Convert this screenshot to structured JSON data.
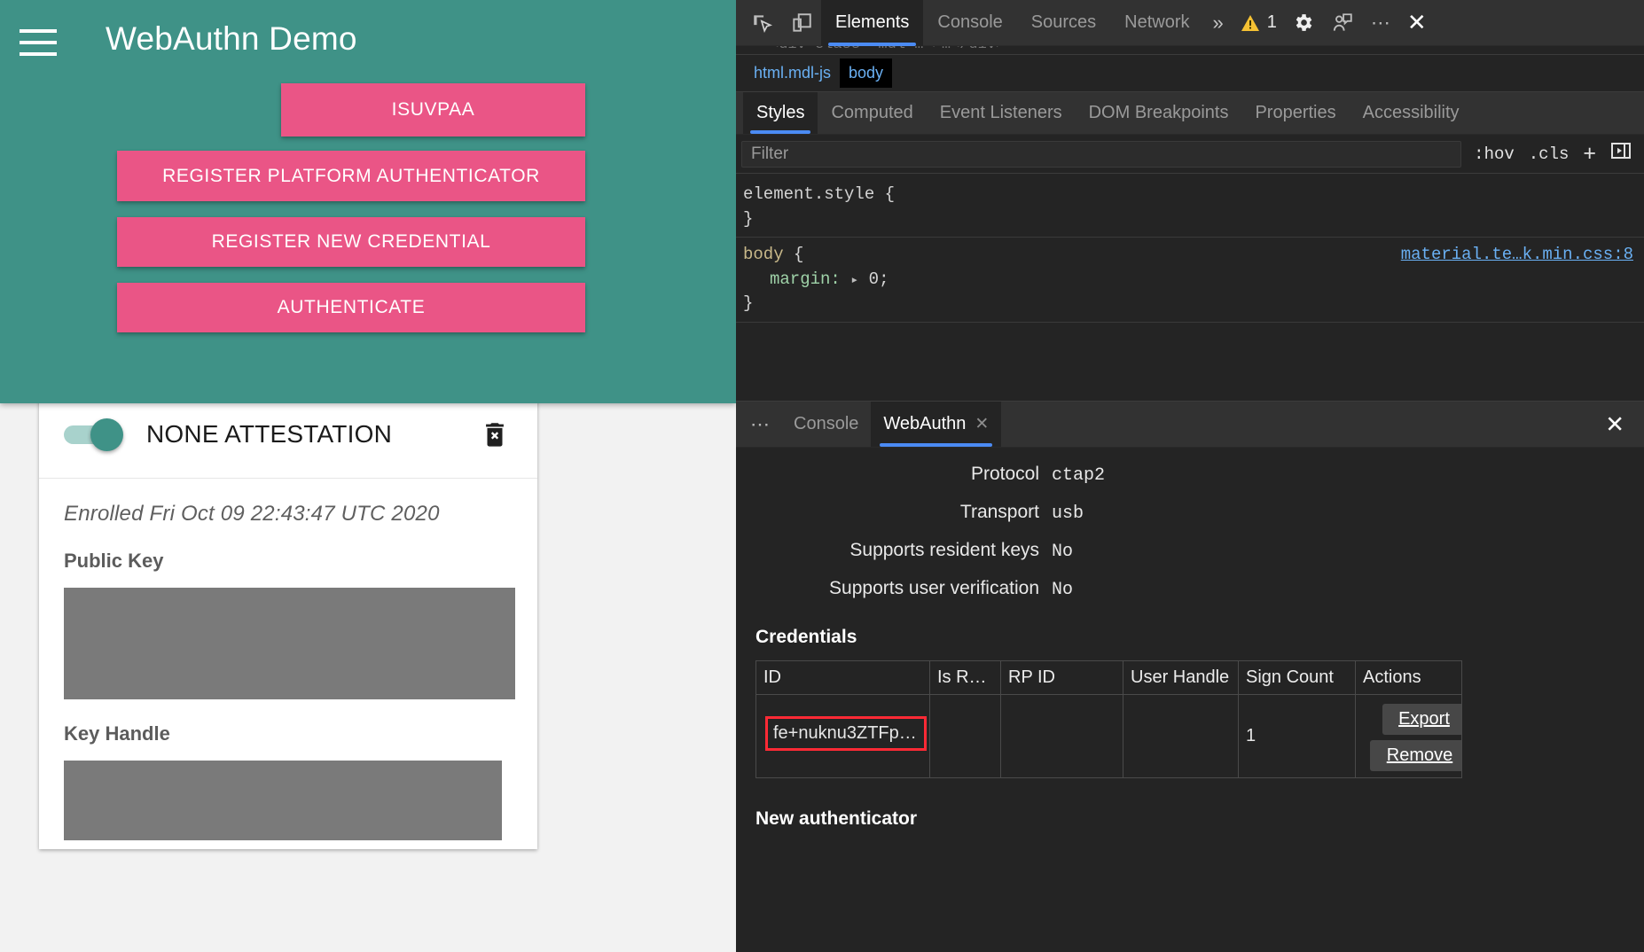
{
  "page": {
    "title": "WebAuthn Demo",
    "menu_icon": "hamburger-icon",
    "buttons": {
      "isuvpaa": "ISUVPAA",
      "register_platform": "REGISTER PLATFORM AUTHENTICATOR",
      "register_new": "REGISTER NEW CREDENTIAL",
      "authenticate": "AUTHENTICATE"
    },
    "credential_card": {
      "toggle_label": "NONE ATTESTATION",
      "toggle_on": true,
      "delete_icon": "trash-delete-forever-icon",
      "enrolled": "Enrolled Fri Oct 09 22:43:47 UTC 2020",
      "public_key_label": "Public Key",
      "key_handle_label": "Key Handle",
      "public_key_value": "",
      "key_handle_value": ""
    },
    "colors": {
      "teal": "#3f9287",
      "pink": "#ea5586",
      "redacted_gray": "#7a7a7a"
    }
  },
  "devtools": {
    "toolbar": {
      "inspect_icon": "inspect-element-icon",
      "device_icon": "device-toolbar-icon",
      "tabs": [
        {
          "label": "Elements",
          "active": true
        },
        {
          "label": "Console",
          "active": false
        },
        {
          "label": "Sources",
          "active": false
        },
        {
          "label": "Network",
          "active": false
        }
      ],
      "more_tabs_icon": "chevron-double-right-icon",
      "warning_icon": "warning-triangle-icon",
      "warning_count": "1",
      "settings_icon": "gear-icon",
      "feedback_icon": "person-feedback-icon",
      "more_icon": "more-options-icon",
      "close_icon": "close-icon"
    },
    "elements": {
      "ghost_row": "<div class=\"mdl-…\">…</div>",
      "breadcrumb": [
        {
          "label": "html.mdl-js",
          "selected": false
        },
        {
          "label": "body",
          "selected": true
        }
      ]
    },
    "styles": {
      "tabs": [
        {
          "label": "Styles",
          "active": true
        },
        {
          "label": "Computed",
          "active": false
        },
        {
          "label": "Event Listeners",
          "active": false
        },
        {
          "label": "DOM Breakpoints",
          "active": false
        },
        {
          "label": "Properties",
          "active": false
        },
        {
          "label": "Accessibility",
          "active": false
        }
      ],
      "filter_placeholder": "Filter",
      "filter_value": "",
      "hov_label": ":hov",
      "cls_label": ".cls",
      "new_rule_label": "+",
      "sidebar_toggle_icon": "sidebar-toggle-icon",
      "rules": [
        {
          "selector": "element.style",
          "open_brace": " {",
          "close_brace": "}",
          "source": "",
          "declarations": []
        },
        {
          "selector": "body",
          "open_brace": " {",
          "close_brace": "}",
          "source": "material.te…k.min.css:8",
          "declarations": [
            {
              "name": "margin:",
              "value": "0;"
            }
          ]
        }
      ]
    },
    "drawer": {
      "more_icon": "more-options-icon",
      "tabs": [
        {
          "label": "Console",
          "active": false,
          "closable": false
        },
        {
          "label": "WebAuthn",
          "active": true,
          "closable": true
        }
      ],
      "tab_close_icon": "close-icon",
      "close_icon": "close-icon",
      "webauthn": {
        "properties": [
          {
            "key": "Protocol",
            "value": "ctap2"
          },
          {
            "key": "Transport",
            "value": "usb"
          },
          {
            "key": "Supports resident keys",
            "value": "No"
          },
          {
            "key": "Supports user verification",
            "value": "No"
          }
        ],
        "credentials_heading": "Credentials",
        "columns": [
          "ID",
          "Is R…",
          "RP ID",
          "User Handle",
          "Sign Count",
          "Actions"
        ],
        "rows": [
          {
            "id": "fe+nuknu3ZTFpZ…",
            "is_resident": "",
            "rp_id": "",
            "user_handle": "",
            "sign_count": "1",
            "export_label": "Export",
            "remove_label": "Remove"
          }
        ],
        "highlight_color": "#ff2a35",
        "new_authenticator_heading": "New authenticator"
      }
    }
  }
}
